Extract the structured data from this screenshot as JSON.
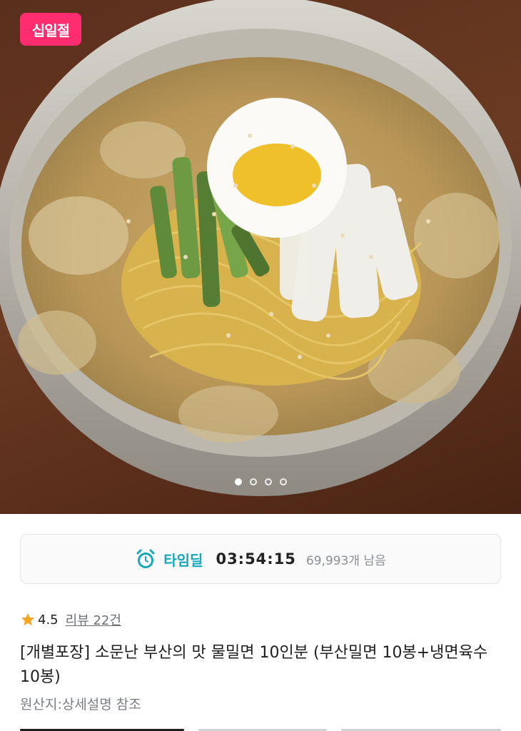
{
  "hero": {
    "badge_text": "십일절",
    "carousel_pages": 4,
    "carousel_active": 1
  },
  "timedeal": {
    "label": "타임딜",
    "timer": "03:54:15",
    "remaining": "69,993개 남음"
  },
  "product": {
    "rating": "4.5",
    "review_text": "리뷰 22건",
    "title": "[개별포장] 소문난 부산의 맛 물밀면 10인분 (부산밀면 10봉+냉면육수 10봉)",
    "origin": "원산지:상세설명 참조"
  },
  "colors": {
    "badge": "#ff2d6f",
    "timedeal_accent": "#16a7b8",
    "star": "#f5a623"
  }
}
